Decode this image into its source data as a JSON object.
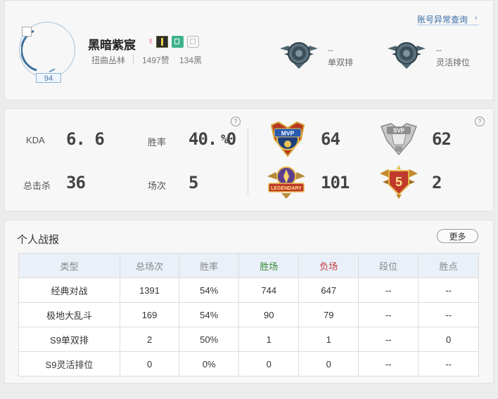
{
  "profile": {
    "name": "黑暗紫宸",
    "gender_symbol": "♀",
    "level": "94",
    "server": "扭曲丛林",
    "likes": "1497赞",
    "dislikes": "134黑",
    "anomaly_link": "账号异常查询",
    "anomaly_arrow": "›"
  },
  "ranks": [
    {
      "value": "--",
      "label": "单双排"
    },
    {
      "value": "--",
      "label": "灵活排位"
    }
  ],
  "stats": {
    "help_symbol": "?",
    "kda_label": "KDA",
    "kda": "6. 6",
    "winrate_label": "胜率",
    "winrate_num": "40. 0",
    "winrate_unit": "%",
    "kills_label": "总击杀",
    "kills": "36",
    "games_label": "场次",
    "games": "5",
    "badges": [
      {
        "icon": "mvp-badge-icon",
        "text": "MVP",
        "value": "64"
      },
      {
        "icon": "svp-badge-icon",
        "text": "SVP",
        "value": "62"
      },
      {
        "icon": "legendary-badge-icon",
        "text": "LEGENDARY",
        "value": "101"
      },
      {
        "icon": "penta-kill-badge-icon",
        "text": "5",
        "value": "2"
      }
    ]
  },
  "report": {
    "title": "个人战报",
    "more_label": "更多",
    "columns": [
      "类型",
      "总场次",
      "胜率",
      "胜场",
      "负场",
      "段位",
      "胜点"
    ],
    "rows": [
      [
        "经典对战",
        "1391",
        "54%",
        "744",
        "647",
        "--",
        "--"
      ],
      [
        "极地大乱斗",
        "169",
        "54%",
        "90",
        "79",
        "--",
        "--"
      ],
      [
        "S9单双排",
        "2",
        "50%",
        "1",
        "1",
        "--",
        "0"
      ],
      [
        "S9灵活排位",
        "0",
        "0%",
        "0",
        "0",
        "--",
        "--"
      ]
    ]
  },
  "colors": {
    "win": "#3a8a3a",
    "loss": "#c23d3d",
    "link": "#3a6ea5",
    "header_bg": "#e9f0f8"
  }
}
